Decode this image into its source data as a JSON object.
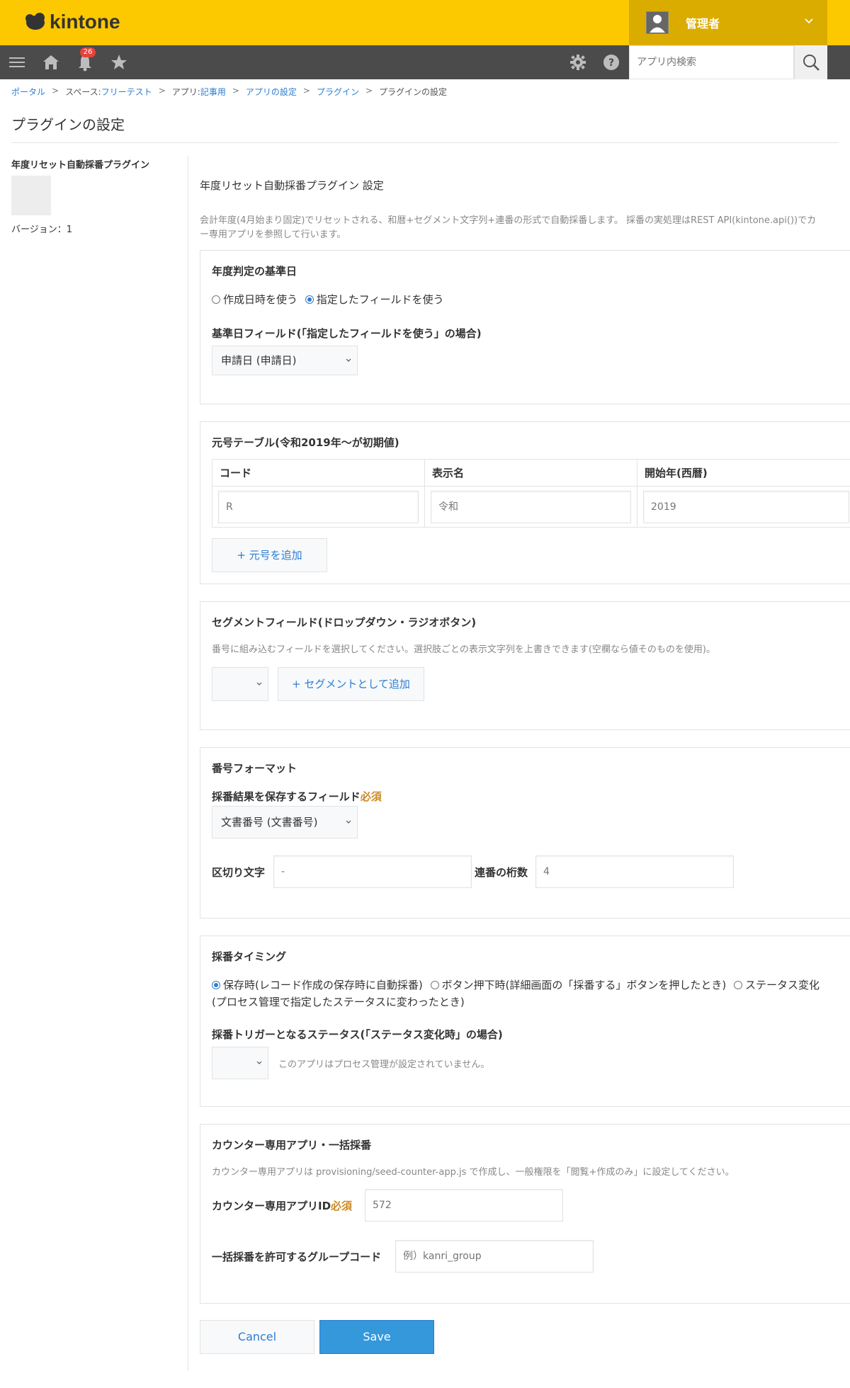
{
  "header": {
    "logo_text": "kintone",
    "user_name": "管理者",
    "notification_count": "26",
    "search_placeholder": "アプリ内検索"
  },
  "breadcrumb": {
    "portal": "ポータル",
    "space_prefix": "スペース: ",
    "space": "フリーテスト",
    "app_prefix": "アプリ: ",
    "app": "記事用",
    "app_settings": "アプリの設定",
    "plugins": "プラグイン",
    "current": "プラグインの設定",
    "separator": ">"
  },
  "page_title": "プラグインの設定",
  "left": {
    "plugin_name": "年度リセット自動採番プラグイン",
    "version": "バージョン：1"
  },
  "main": {
    "title": "年度リセット自動採番プラグイン 設定",
    "desc_line1": "会計年度(4月始まり固定)でリセットされる、和暦+セグメント文字列+連番の形式で自動採番します。 採番の実処理はREST API(kintone.api())でカ",
    "desc_line2": "ー専用アプリを参照して行います。"
  },
  "basis": {
    "title": "年度判定の基準日",
    "opt_created": "作成日時を使う",
    "opt_field": "指定したフィールドを使う",
    "field_label": "基準日フィールド(「指定したフィールドを使う」の場合)",
    "field_value": "申請日 (申請日)"
  },
  "era": {
    "title": "元号テーブル(令和2019年〜が初期値)",
    "col_code": "コード",
    "col_name": "表示名",
    "col_year": "開始年(西暦)",
    "row_code": "R",
    "row_name": "令和",
    "row_year": "2019",
    "add_label": "+ 元号を追加"
  },
  "segment": {
    "title": "セグメントフィールド(ドロップダウン・ラジオボタン)",
    "note": "番号に組み込むフィールドを選択してください。選択肢ごとの表示文字列を上書きできます(空欄なら値そのものを使用)。",
    "select_value": "",
    "add_label": "+ セグメントとして追加"
  },
  "format": {
    "title": "番号フォーマット",
    "save_field_label": "採番結果を保存するフィールド",
    "required": "必須",
    "save_field_value": "文書番号 (文書番号)",
    "separator_label": "区切り文字",
    "separator_placeholder": "-",
    "digits_label": "連番の桁数",
    "digits_placeholder": "4"
  },
  "timing": {
    "title": "採番タイミング",
    "opt_save": "保存時(レコード作成の保存時に自動採番)",
    "opt_button": "ボタン押下時(詳細画面の「採番する」ボタンを押したとき)",
    "opt_status": "ステータス変化",
    "opt_status_cont": "(プロセス管理で指定したステータスに変わったとき)",
    "status_label": "採番トリガーとなるステータス(「ステータス変化時」の場合)",
    "status_note": "このアプリはプロセス管理が設定されていません。"
  },
  "counter": {
    "title": "カウンター専用アプリ・一括採番",
    "note": "カウンター専用アプリは provisioning/seed-counter-app.js で作成し、一般権限を「閲覧+作成のみ」に設定してください。",
    "app_id_label": "カウンター専用アプリID",
    "required": "必須",
    "app_id_placeholder": "572",
    "group_label": "一括採番を許可するグループコード",
    "group_placeholder": "例）kanri_group"
  },
  "actions": {
    "cancel": "Cancel",
    "save": "Save"
  },
  "colors": {
    "header_yellow": "#fcc800",
    "user_area": "#dbac00",
    "nav_bg": "#4b4b4b",
    "link_blue": "#2d7dd2",
    "save_blue": "#3498db",
    "required": "#cc8a26"
  }
}
